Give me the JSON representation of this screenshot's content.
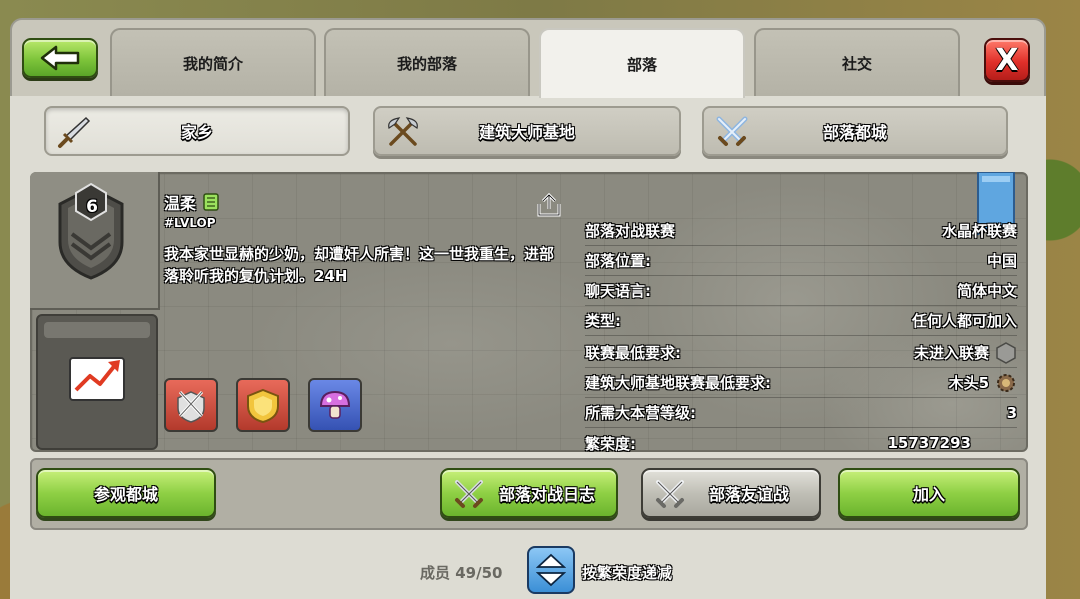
{
  "tabs": [
    {
      "label": "我的简介"
    },
    {
      "label": "我的部落"
    },
    {
      "label": "部落"
    },
    {
      "label": "社交"
    }
  ],
  "close_label": "X",
  "subtabs": [
    {
      "label": "家乡",
      "icon": "sword-icon"
    },
    {
      "label": "建筑大师基地",
      "icon": "crossed-axes-icon"
    },
    {
      "label": "部落都城",
      "icon": "crossed-swords-icon"
    }
  ],
  "clan": {
    "level": "6",
    "name": "温柔",
    "tag": "#LVLOP",
    "description": "我本家世显赫的少奶，却遭奸人所害！这一世我重生，进部落聆听我的复仇计划。24H"
  },
  "stats": [
    {
      "label": "部落对战联赛",
      "value": "水晶杯联赛"
    },
    {
      "label": "部落位置:",
      "value": "中国"
    },
    {
      "label": "聊天语言:",
      "value": "简体中文"
    },
    {
      "label": "类型:",
      "value": "任何人都可加入"
    },
    {
      "label": "联赛最低要求:",
      "value": "未进入联赛",
      "icon": "hexagon-icon"
    },
    {
      "label": "建筑大师基地联赛最低要求:",
      "value": "木头5",
      "icon": "gear-icon"
    },
    {
      "label": "所需大本营等级:",
      "value": "3"
    },
    {
      "label": "繁荣度:",
      "value": "15737293"
    }
  ],
  "buttons": {
    "visit_capital": "参观都城",
    "war_log": "部落对战日志",
    "friendly_war": "部落友谊战",
    "join": "加入"
  },
  "members": "成员 49/50",
  "sort_label": "按繁荣度递减",
  "colors": {
    "green_button": "#8fd045",
    "red_button": "#e0302a",
    "panel": "#c9c7bb",
    "card": "#8b8a80"
  }
}
